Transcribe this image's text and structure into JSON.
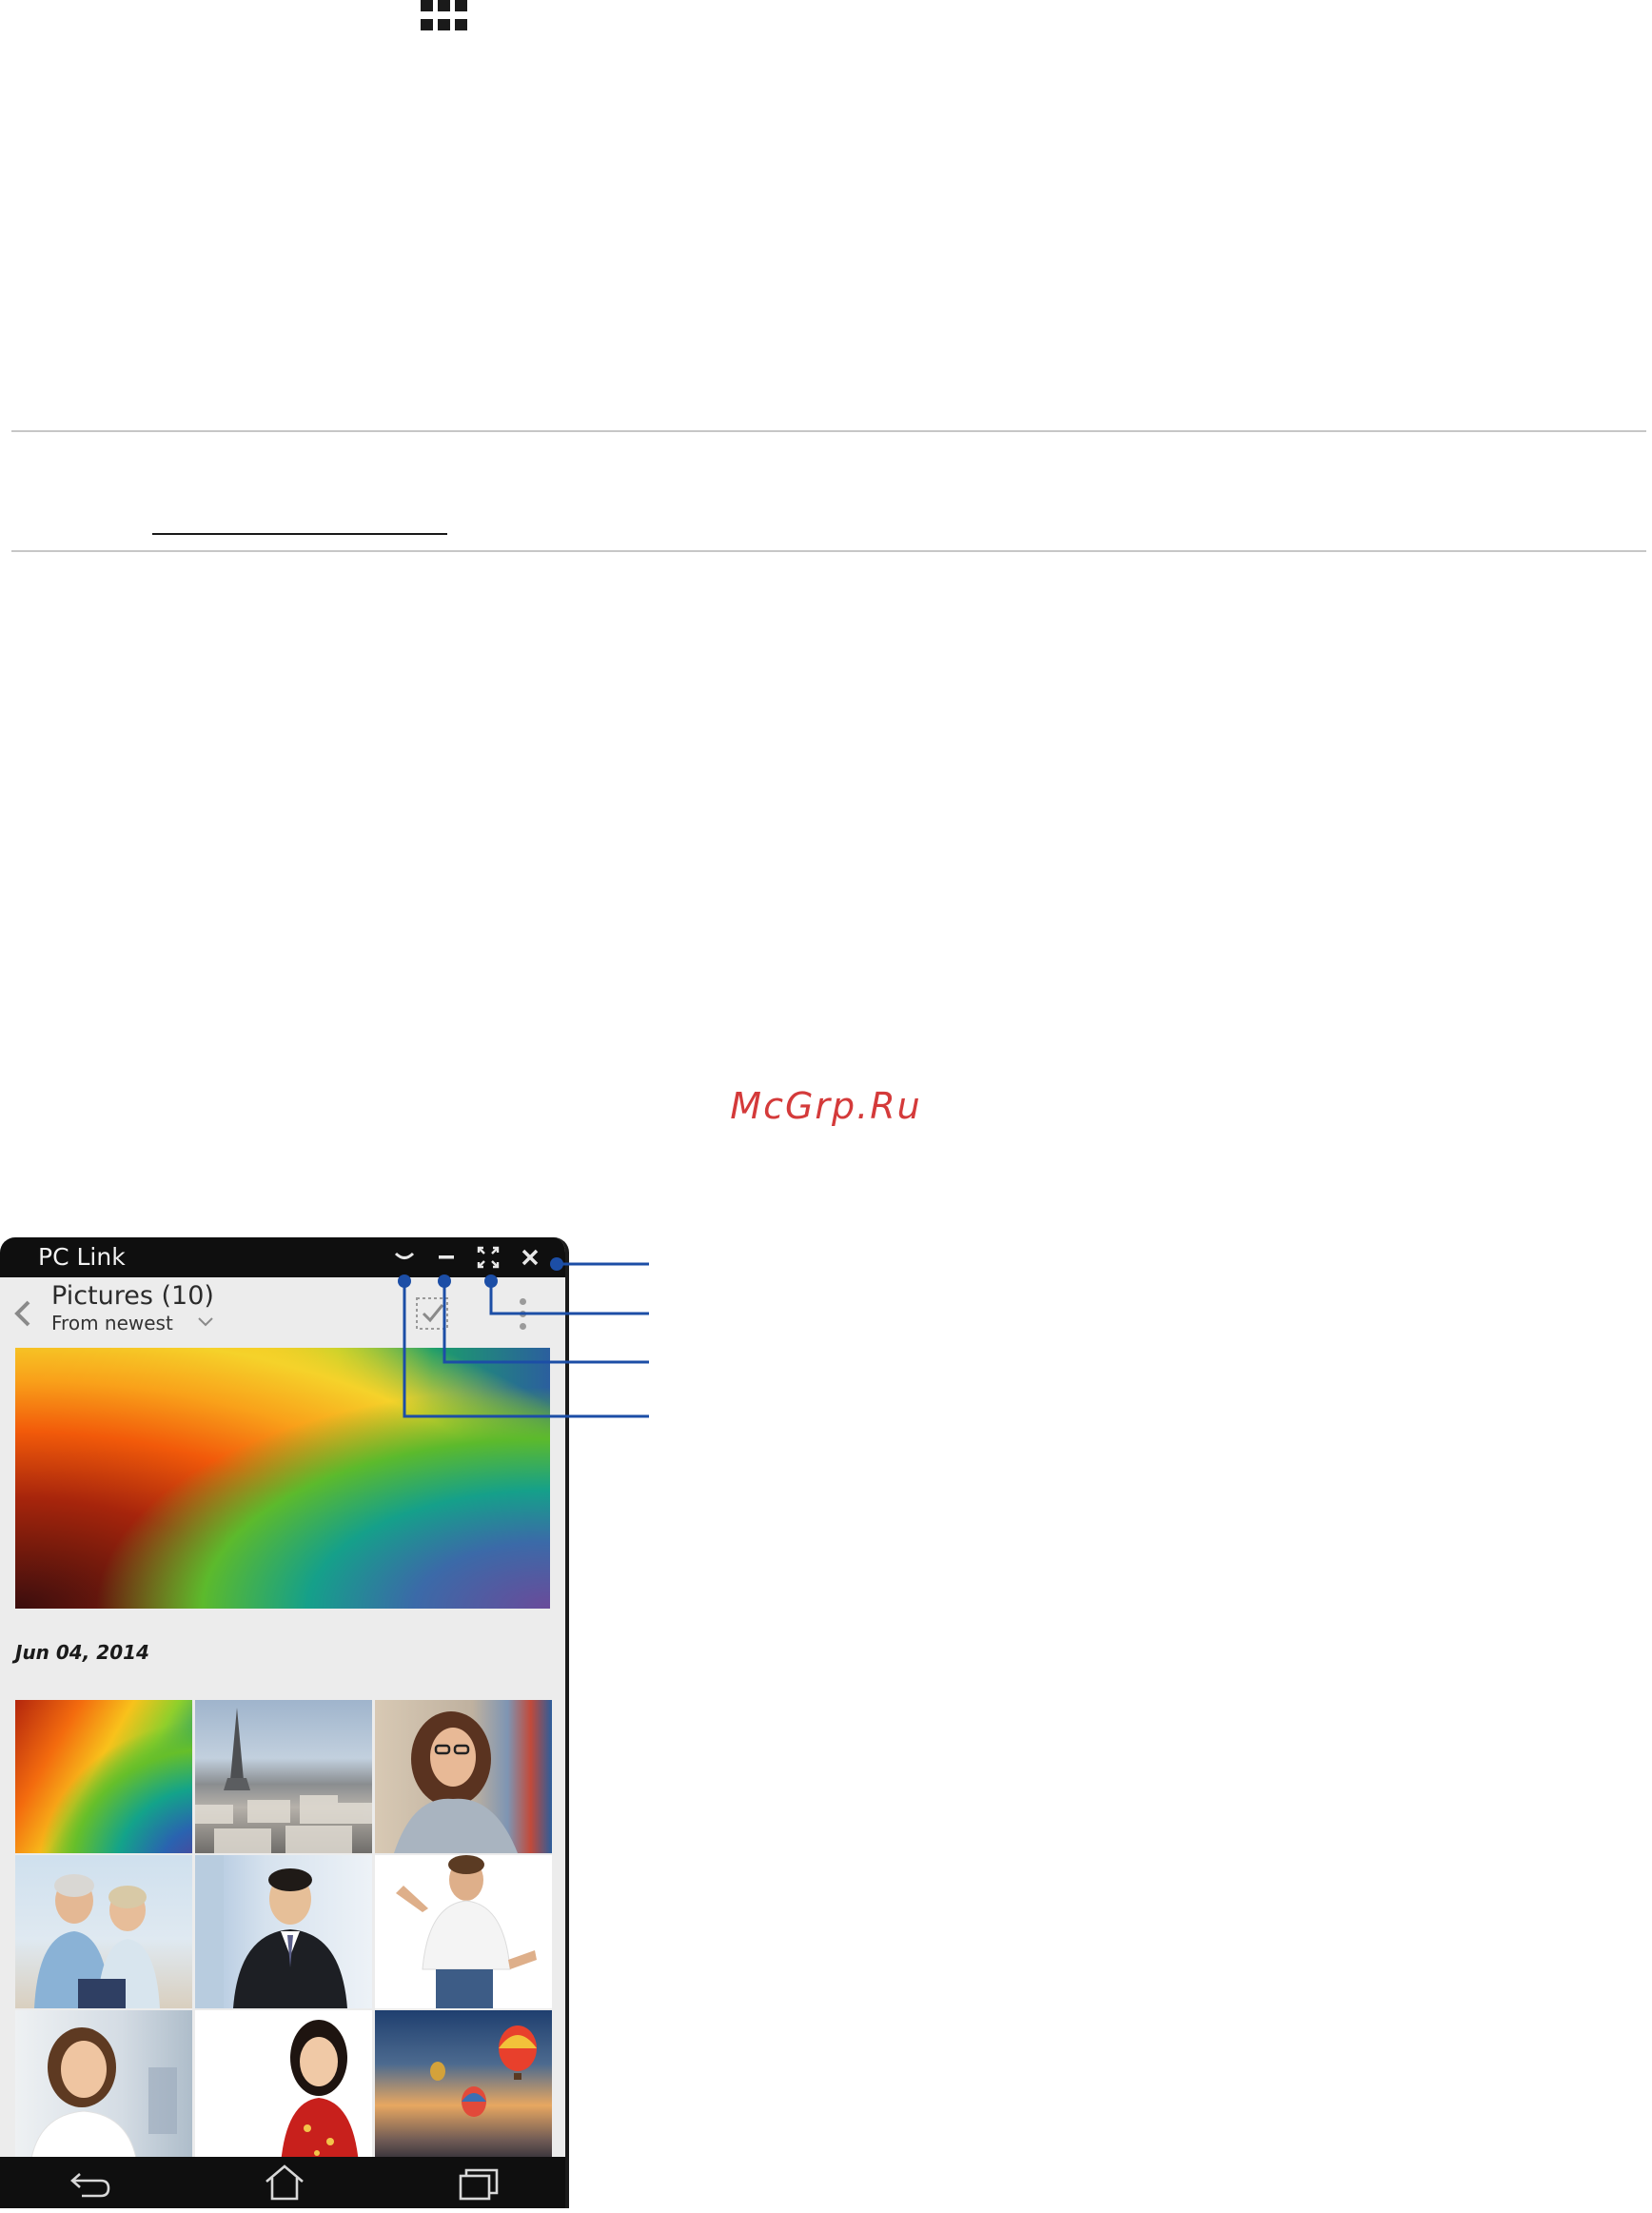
{
  "watermark": "McGrp.Ru",
  "window": {
    "title": "PC Link",
    "controls": [
      "hide-window",
      "minimize",
      "fullscreen",
      "close"
    ]
  },
  "gallery": {
    "title": "Pictures (10)",
    "sort": "From newest",
    "date": "Jun 04,  2014",
    "thumbnails": [
      "rainbow-paper-thumbnail",
      "eiffel-tower-city-thumbnail",
      "smiling-woman-glasses-thumbnail",
      "senior-couple-beach-thumbnail",
      "businessman-thumbnail",
      "man-white-tshirt-thumbnail",
      "businesswoman-thumbnail",
      "woman-red-dress-thumbnail",
      "hot-air-balloons-thumbnail"
    ]
  },
  "navbar": {
    "icons": [
      "back-icon",
      "home-icon",
      "recent-apps-icon"
    ]
  },
  "colors": {
    "callout_line": "#1c4ea6",
    "watermark": "#d43a3a",
    "titlebar": "#0f0f0f"
  }
}
